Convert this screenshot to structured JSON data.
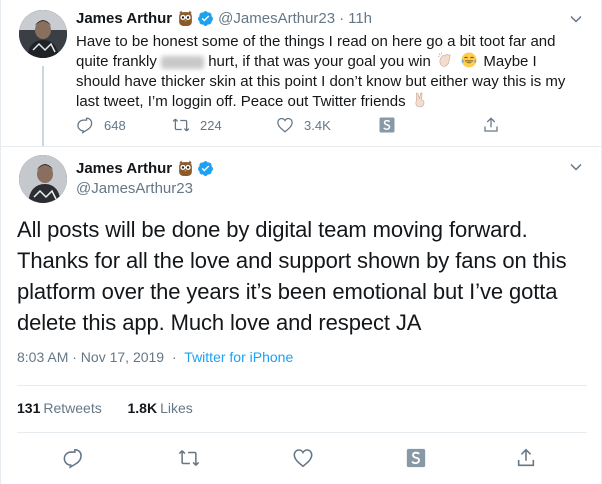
{
  "tweet1": {
    "name": "James Arthur",
    "handle": "@JamesArthur23",
    "dot": "·",
    "time": "11h",
    "text_a": "Have to be honest some of the things I read on here go a bit toot far and quite frankly",
    "text_b": "hurt, if that was your goal you win",
    "text_c": "Maybe I should have thicker skin at this point I don’t know but either way this is my last tweet, I’m loggin off. Peace out Twitter friends",
    "replies": "648",
    "retweets": "224",
    "likes": "3.4K"
  },
  "tweet2": {
    "name": "James Arthur",
    "handle": "@JamesArthur23",
    "text": "All posts will be done by digital team moving forward. Thanks for all the love and support shown by fans on this platform over the years it’s been emotional but I’ve gotta delete this app. Much love and respect JA",
    "timestamp": "8:03 AM · Nov 17, 2019",
    "dot": "·",
    "source": "Twitter for iPhone",
    "retweets_count": "131",
    "retweets_label": "Retweets",
    "likes_count": "1.8K",
    "likes_label": "Likes"
  },
  "icons": [
    "owl-emoji-icon",
    "verified-badge-icon",
    "chevron-down-icon",
    "reply-icon",
    "retweet-icon",
    "like-icon",
    "stack-s-icon",
    "share-icon",
    "clap-emoji-icon",
    "laughing-emoji-icon",
    "victory-hand-emoji-icon"
  ],
  "colors": {
    "accent": "#1da1f2",
    "secondary_text": "#657786",
    "primary_text": "#14171a",
    "border": "#e6ecf0"
  }
}
